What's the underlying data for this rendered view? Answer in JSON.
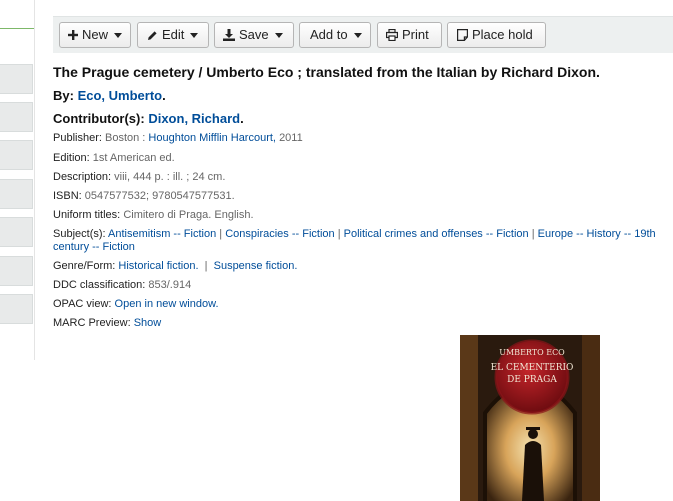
{
  "toolbar": {
    "new": "New",
    "edit": "Edit",
    "save": "Save",
    "add_to": "Add to",
    "print": "Print",
    "place_hold": "Place hold"
  },
  "record": {
    "title": "The Prague cemetery / Umberto Eco ; translated from the Italian by Richard Dixon.",
    "by_label": "By:",
    "by_name": "Eco, Umberto",
    "contributors_label": "Contributor(s):",
    "contributor_name": "Dixon, Richard",
    "publisher_label": "Publisher:",
    "publisher_place": "Boston :",
    "publisher_name": "Houghton Mifflin Harcourt,",
    "publisher_year": "2011",
    "edition_label": "Edition:",
    "edition_value": "1st American ed.",
    "description_label": "Description:",
    "description_value": "viii, 444 p. : ill. ; 24 cm.",
    "isbn_label": "ISBN:",
    "isbn_value": "0547577532; 9780547577531.",
    "uniform_label": "Uniform titles:",
    "uniform_value": "Cimitero di Praga. English.",
    "subjects_label": "Subject(s):",
    "subjects": [
      "Antisemitism -- Fiction",
      "Conspiracies -- Fiction",
      "Political crimes and offenses -- Fiction",
      "Europe -- History -- 19th",
      "century -- Fiction"
    ],
    "genre_label": "Genre/Form:",
    "genres": [
      "Historical fiction.",
      "Suspense fiction."
    ],
    "ddc_label": "DDC classification:",
    "ddc_value": "853/.914",
    "opac_label": "OPAC view:",
    "opac_link": "Open in new window.",
    "marc_label": "MARC Preview:",
    "marc_link": "Show"
  },
  "cover": {
    "author": "UMBERTO ECO",
    "title_line1": "EL CEMENTERIO",
    "title_line2": "DE PRAGA"
  }
}
